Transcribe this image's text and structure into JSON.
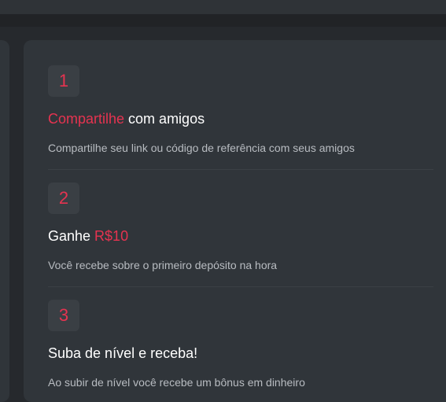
{
  "steps": [
    {
      "number": "1",
      "title_accent": "Compartilhe",
      "title_rest": " com amigos",
      "description": "Compartilhe seu link ou código de referência com seus amigos"
    },
    {
      "number": "2",
      "title_plain": "Ganhe ",
      "title_accent": "R$10",
      "description": "Você recebe sobre o primeiro depósito na hora"
    },
    {
      "number": "3",
      "title": "Suba de nível e receba!",
      "description": "Ao subir de nível você recebe um bônus em dinheiro"
    }
  ],
  "colors": {
    "accent": "#e63350",
    "panel": "#30353a",
    "background": "#26292d"
  }
}
